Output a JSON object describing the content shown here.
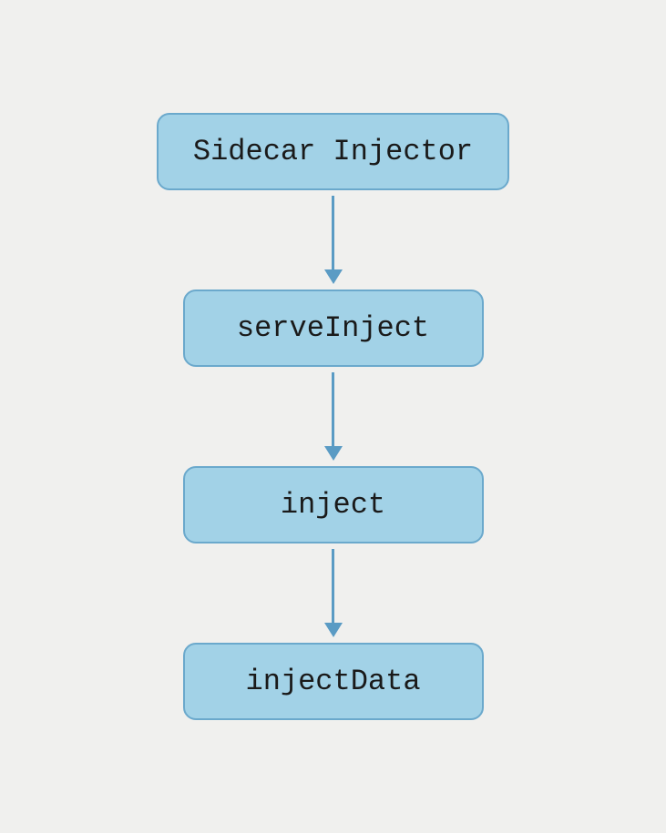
{
  "nodes": [
    {
      "label": "Sidecar Injector"
    },
    {
      "label": "serveInject"
    },
    {
      "label": "inject"
    },
    {
      "label": "injectData"
    }
  ],
  "colors": {
    "node_fill": "#a2d2e7",
    "node_border": "#6ba9cc",
    "arrow": "#5a9bc4",
    "background": "#f0f0ee"
  }
}
